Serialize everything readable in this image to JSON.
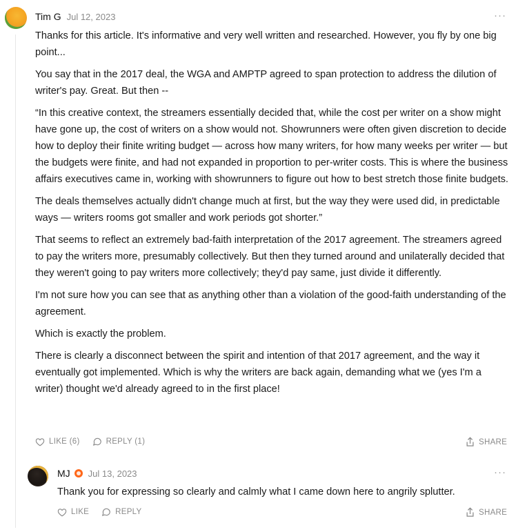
{
  "comment": {
    "author": "Tim G",
    "date": "Jul 12, 2023",
    "more": "···",
    "paragraphs": [
      "Thanks for this article. It's informative and very well written and researched. However, you fly by one big point...",
      "You say that in the 2017 deal, the WGA and AMPTP agreed to span protection to address the dilution of writer's pay. Great. But then --",
      "“In this creative context, the streamers essentially decided that, while the cost per writer on a show might have gone up, the cost of writers on a show would not.  Showrunners were often given discretion to decide how to deploy their finite writing budget — across how many writers, for how many weeks per writer — but the budgets were finite, and had not expanded in proportion to per-writer costs.  This is where the business affairs executives came in, working with showrunners to figure out how to best stretch those finite budgets.",
      "The deals themselves actually didn't change much at first, but the way they were used did, in predictable ways — writers rooms got smaller and work periods got shorter.”",
      "That seems to reflect an extremely bad-faith interpretation of the 2017 agreement. The streamers agreed to pay the writers more, presumably collectively. But then they turned around and unilaterally decided that they weren't going to pay writers more collectively; they'd pay same, just divide it differently.",
      "I'm not sure how you can see that as anything other than a violation of the good-faith understanding of the agreement.",
      "Which is exactly the problem.",
      "There is clearly a disconnect between the spirit and intention of that 2017 agreement, and the way it eventually got implemented. Which is why the writers are back again, demanding what we (yes I'm a writer) thought we'd already agreed to in the first place!"
    ],
    "like_label": "LIKE (6)",
    "reply_label": "REPLY (1)",
    "share_label": "SHARE"
  },
  "reply": {
    "author": "MJ",
    "date": "Jul 13, 2023",
    "more": "···",
    "text": "Thank you for expressing so clearly and calmly what I came down here to angrily splutter.",
    "like_label": "LIKE",
    "reply_label": "REPLY",
    "share_label": "SHARE"
  },
  "colors": {
    "badge": "#ff6719",
    "meta": "#8a8a8a"
  },
  "icons": [
    "heart-icon",
    "speech-bubble-icon",
    "share-icon",
    "ellipsis-icon",
    "subscriber-badge-icon"
  ]
}
